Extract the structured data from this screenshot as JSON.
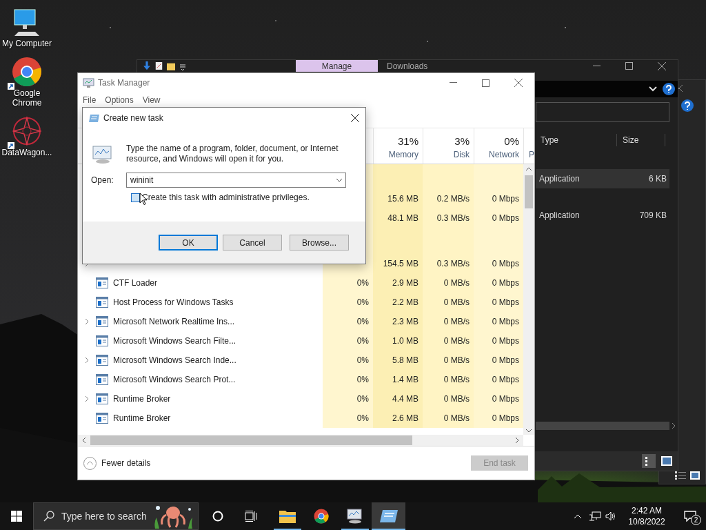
{
  "desktop": {
    "icons": [
      {
        "kind": "computer",
        "label": "My Computer"
      },
      {
        "kind": "chrome",
        "label": "Google Chrome"
      },
      {
        "kind": "app",
        "label": "DataWagon..."
      }
    ]
  },
  "explorer": {
    "ribbon_tab": "Manage",
    "title": "Downloads",
    "columns": [
      "Type",
      "Size"
    ],
    "rows": [
      {
        "type": "Application",
        "size": "6 KB",
        "selected": true
      },
      {
        "type": "Application",
        "size": "709 KB",
        "selected": false
      }
    ]
  },
  "task_manager": {
    "title": "Task Manager",
    "menu": [
      "File",
      "Options",
      "View"
    ],
    "columns": [
      {
        "percent": "31%",
        "label": "Memory"
      },
      {
        "percent": "3%",
        "label": "Disk"
      },
      {
        "percent": "0%",
        "label": "Network"
      },
      {
        "label": "P"
      }
    ],
    "rows": [
      {
        "kind": "group"
      },
      {
        "kind": "process",
        "memory": "15.6 MB",
        "disk": "0.2 MB/s",
        "network": "0 Mbps"
      },
      {
        "kind": "process",
        "memory": "48.1 MB",
        "disk": "0.3 MB/s",
        "network": "0 Mbps"
      },
      {
        "kind": "group"
      },
      {
        "kind": "process",
        "expandable": true,
        "memory": "154.5 MB",
        "disk": "0.3 MB/s",
        "network": "0 Mbps"
      },
      {
        "kind": "process",
        "name": "CTF Loader",
        "expandable": false,
        "cpu": "0%",
        "memory": "2.9 MB",
        "disk": "0 MB/s",
        "network": "0 Mbps"
      },
      {
        "kind": "process",
        "name": "Host Process for Windows Tasks",
        "expandable": false,
        "cpu": "0%",
        "memory": "2.2 MB",
        "disk": "0 MB/s",
        "network": "0 Mbps"
      },
      {
        "kind": "process",
        "name": "Microsoft Network Realtime Ins...",
        "expandable": true,
        "cpu": "0%",
        "memory": "2.3 MB",
        "disk": "0 MB/s",
        "network": "0 Mbps"
      },
      {
        "kind": "process",
        "name": "Microsoft Windows Search Filte...",
        "expandable": false,
        "cpu": "0%",
        "memory": "1.0 MB",
        "disk": "0 MB/s",
        "network": "0 Mbps"
      },
      {
        "kind": "process",
        "name": "Microsoft Windows Search Inde...",
        "expandable": true,
        "cpu": "0%",
        "memory": "5.8 MB",
        "disk": "0 MB/s",
        "network": "0 Mbps"
      },
      {
        "kind": "process",
        "name": "Microsoft Windows Search Prot...",
        "expandable": false,
        "cpu": "0%",
        "memory": "1.4 MB",
        "disk": "0 MB/s",
        "network": "0 Mbps"
      },
      {
        "kind": "process",
        "name": "Runtime Broker",
        "expandable": true,
        "cpu": "0%",
        "memory": "4.4 MB",
        "disk": "0 MB/s",
        "network": "0 Mbps"
      },
      {
        "kind": "process",
        "name": "Runtime Broker",
        "expandable": false,
        "cpu": "0%",
        "memory": "2.6 MB",
        "disk": "0 MB/s",
        "network": "0 Mbps"
      }
    ],
    "details_toggle": "Fewer details",
    "end_task": {
      "label": "End task",
      "disabled": true
    }
  },
  "dialog": {
    "title": "Create new task",
    "message": "Type the name of a program, folder, document, or Internet resource, and Windows will open it for you.",
    "open_label": "Open:",
    "open_value": "wininit",
    "admin_checkbox": {
      "label": "Create this task with administrative privileges.",
      "checked": false
    },
    "buttons": [
      {
        "label": "OK",
        "default": true
      },
      {
        "label": "Cancel",
        "default": false
      },
      {
        "label": "Browse...",
        "default": false
      }
    ]
  },
  "taskbar": {
    "search_placeholder": "Type here to search",
    "apps": [
      {
        "kind": "explorer",
        "open": true,
        "selected": false
      },
      {
        "kind": "chrome",
        "open": false,
        "selected": false
      },
      {
        "kind": "taskmgr",
        "open": true,
        "selected": false
      },
      {
        "kind": "run",
        "open": true,
        "selected": true
      }
    ],
    "time": "2:42 AM",
    "date": "10/8/2022",
    "notifications": "2"
  }
}
